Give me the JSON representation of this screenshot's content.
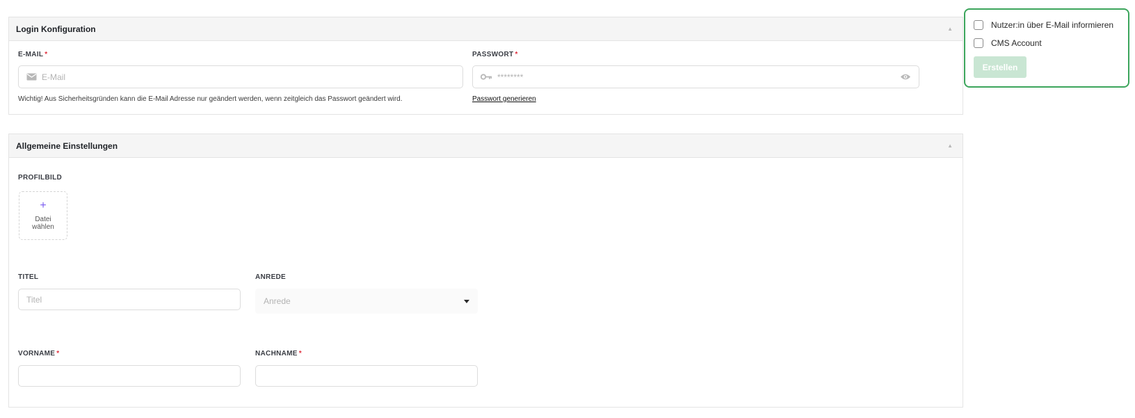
{
  "login_section": {
    "title": "Login Konfiguration",
    "email": {
      "label": "E-MAIL",
      "required_marker": "*",
      "placeholder": "E-Mail",
      "icon": "mail-icon",
      "help_text": "Wichtig! Aus Sicherheitsgründen kann die E-Mail Adresse nur geändert werden, wenn zeitgleich das Passwort geändert wird."
    },
    "password": {
      "label": "PASSWORT",
      "required_marker": "*",
      "placeholder": "********",
      "icon": "key-icon",
      "toggle_icon": "eye-icon",
      "generate_link": "Passwort generieren"
    }
  },
  "general_section": {
    "title": "Allgemeine Einstellungen",
    "profile_image": {
      "label": "PROFILBILD",
      "upload_plus": "+",
      "upload_text": "Datei wählen"
    },
    "title_field": {
      "label": "TITEL",
      "placeholder": "Titel"
    },
    "salutation": {
      "label": "ANREDE",
      "placeholder": "Anrede"
    },
    "first_name": {
      "label": "VORNAME",
      "required_marker": "*",
      "value": ""
    },
    "last_name": {
      "label": "NACHNAME",
      "required_marker": "*",
      "value": ""
    }
  },
  "side_panel": {
    "notify_label": "Nutzer:in über E-Mail informieren",
    "notify_checked": false,
    "cms_label": "CMS Account",
    "cms_checked": false,
    "create_button": "Erstellen"
  },
  "colors": {
    "accent_green": "#3ca55c",
    "button_disabled": "#c9e6d3",
    "required_red": "#e0303e",
    "upload_plus": "#7b5cf0"
  }
}
